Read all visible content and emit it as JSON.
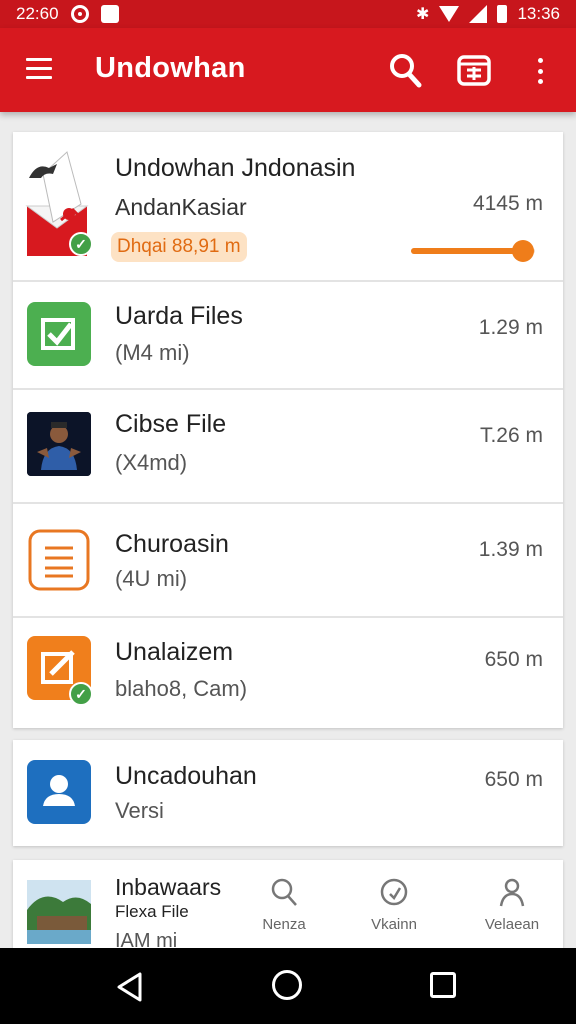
{
  "status_bar": {
    "time_left": "22:60",
    "time_right": "13:36"
  },
  "app_bar": {
    "title": "Undowhan",
    "actions": [
      "search-icon",
      "calendar-icon",
      "more-vert-icon"
    ]
  },
  "downloads": [
    {
      "title": "Undowhan Jndonasin",
      "subtitle": "AndanKasiar",
      "badge": "Dhqai 88,91 m",
      "size": "4145  m",
      "progress": 0.9,
      "icon": "envelope-bird-icon",
      "verified": true
    },
    {
      "title": "Uarda Files",
      "subtitle": "(M4 mi)",
      "size": "1.29  m",
      "icon": "green-check-icon"
    },
    {
      "title": "Cibse File",
      "subtitle": "(X4md)",
      "size": "T.26  m",
      "icon": "person-photo-icon"
    },
    {
      "title": "Churoasin",
      "subtitle": "(4U mi)",
      "size": "1.39  m",
      "icon": "document-icon"
    },
    {
      "title": "Unalaizem",
      "subtitle": "blaho8, Cam)",
      "size": "650  m",
      "icon": "orange-edit-icon",
      "verified": true
    },
    {
      "title": "Uncadouhan",
      "subtitle": "Versi",
      "size": "650  m",
      "icon": "user-icon"
    },
    {
      "title": "Inbawaars",
      "subtitle": "Flexa File",
      "subtitle2": "IAM mi",
      "icon": "landscape-photo-icon"
    }
  ],
  "bottom_nav": [
    {
      "label": "Nenza",
      "icon": "search-icon"
    },
    {
      "label": "Vkainn",
      "icon": "refresh-icon"
    },
    {
      "label": "Velaean",
      "icon": "person-icon"
    }
  ],
  "colors": {
    "primary": "#d7191f",
    "status": "#c7161c",
    "accent": "#ef7d1a",
    "green": "#4caf50",
    "blue": "#1e6fbf"
  }
}
